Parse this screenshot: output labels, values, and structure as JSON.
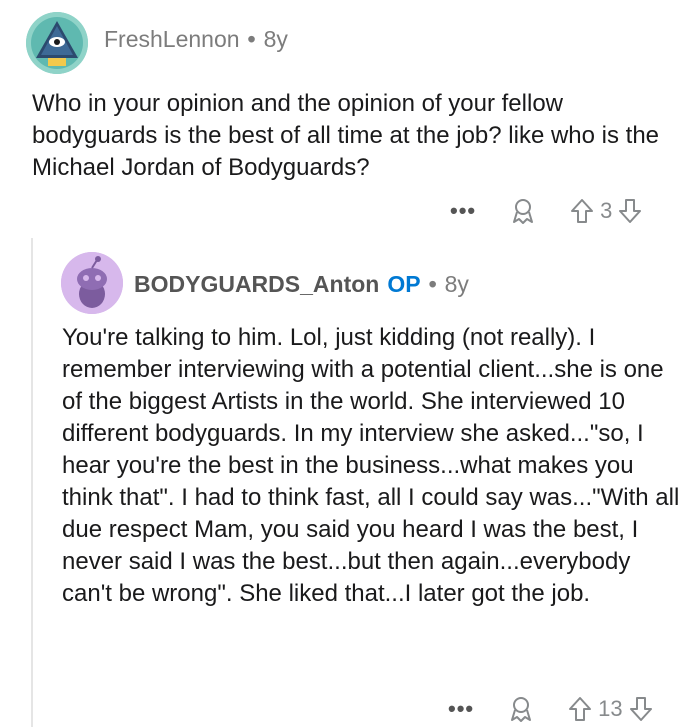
{
  "comment1": {
    "username": "FreshLennon",
    "separator": "•",
    "age": "8y",
    "text": "Who in your opinion and the opinion of your fellow bodyguards is the best of all time at the job? like who is the Michael Jordan of Bodyguards?",
    "more": "•••",
    "score": "3",
    "icons": {
      "avatar": "pyramid-eye-avatar-icon",
      "award": "award-icon",
      "up": "upvote-arrow-icon",
      "down": "downvote-arrow-icon"
    }
  },
  "reply": {
    "username": "BODYGUARDS_Anton",
    "op_badge": "OP",
    "separator": "•",
    "age": "8y",
    "text": "You're talking to him.  Lol, just kidding (not really). I remember interviewing with a potential client...she is one of the biggest Artists in the world.  She interviewed 10 different bodyguards. In my interview she asked...\"so, I hear you're the best in the business...what makes you think that\". I had to think fast, all I could say was...\"With all due respect Mam, you said you heard I was the best, I never said I was the best...but then again...everybody can't be wrong\".  She liked that...I later got the job.",
    "more": "•••",
    "score": "13",
    "icons": {
      "avatar": "snoo-avatar-icon",
      "award": "award-icon",
      "up": "upvote-arrow-icon",
      "down": "downvote-arrow-icon"
    }
  },
  "colors": {
    "op": "#0079d3",
    "meta": "#7c7c7c",
    "threadline": "#e5e5e5"
  }
}
